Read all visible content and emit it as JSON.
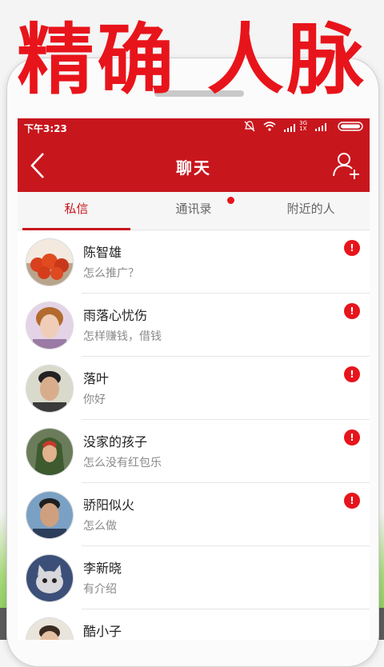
{
  "promo": {
    "headline": "精确 人脉"
  },
  "status_bar": {
    "time": "下午3:23",
    "network": "3G\n1X"
  },
  "header": {
    "title": "聊天"
  },
  "tabs": [
    {
      "label": "私信",
      "active": true
    },
    {
      "label": "通讯录",
      "has_dot": true
    },
    {
      "label": "附近的人"
    }
  ],
  "chats": [
    {
      "name": "陈智雄",
      "message": "怎么推广？",
      "badge": "!",
      "avatar": "tomatoes"
    },
    {
      "name": "雨落心忧伤",
      "message": "怎样赚钱，借钱",
      "badge": "!",
      "avatar": "woman"
    },
    {
      "name": "落叶",
      "message": "你好",
      "badge": "!",
      "avatar": "man"
    },
    {
      "name": "没家的孩子",
      "message": "怎么没有红包乐",
      "badge": "!",
      "avatar": "hooded-character"
    },
    {
      "name": "骄阳似火",
      "message": "怎么做",
      "badge": "!",
      "avatar": "man-blue"
    },
    {
      "name": "李新晓",
      "message": "有介绍",
      "badge": "",
      "avatar": "cat"
    },
    {
      "name": "酷小子",
      "message": "",
      "badge": "",
      "avatar": "person"
    }
  ],
  "colors": {
    "brand_red": "#c8161d",
    "badge_red": "#e8141b"
  }
}
